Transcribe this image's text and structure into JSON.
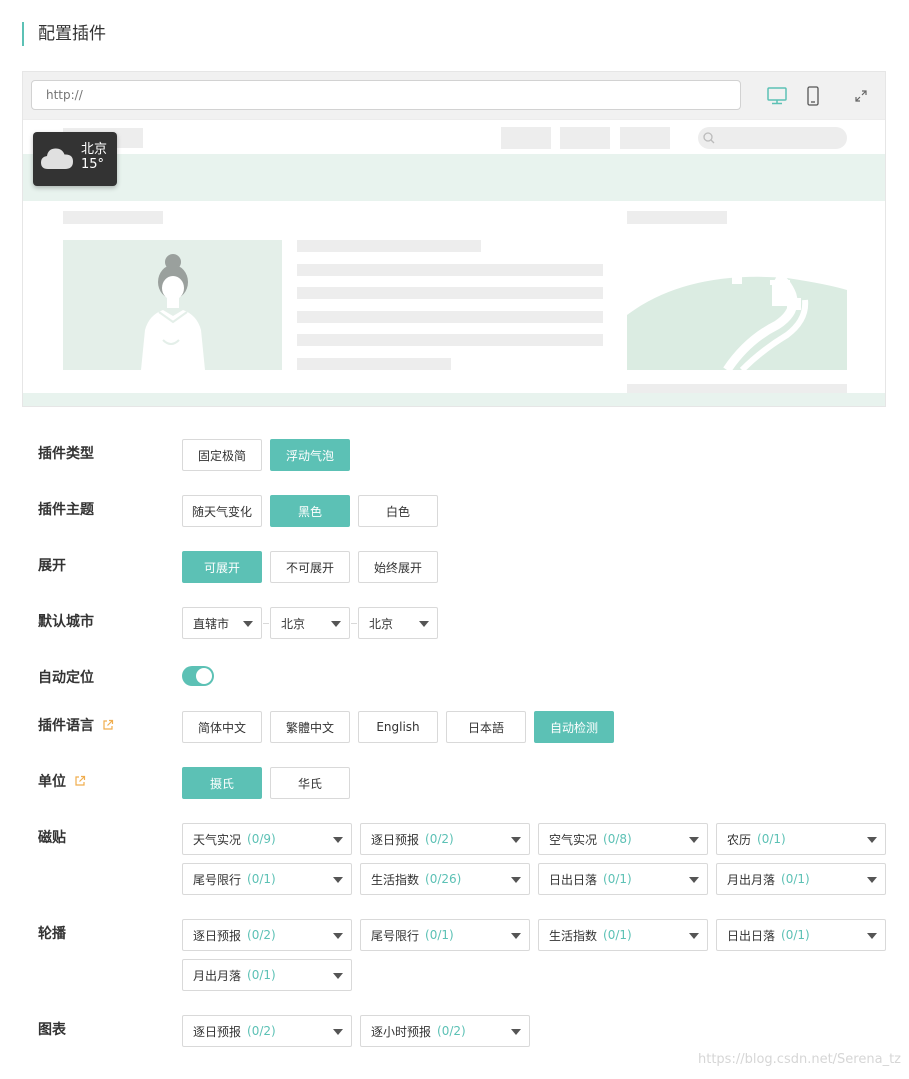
{
  "page_title": "配置插件",
  "preview": {
    "url_placeholder": "http://",
    "device_icons": [
      "desktop-icon",
      "mobile-icon",
      "expand-icon"
    ],
    "widget": {
      "city": "北京",
      "temp": "15°",
      "icon": "cloud-icon"
    }
  },
  "form": {
    "type": {
      "label": "插件类型",
      "options": [
        "固定极简",
        "浮动气泡"
      ],
      "active": 1
    },
    "theme": {
      "label": "插件主题",
      "options": [
        "随天气变化",
        "黑色",
        "白色"
      ],
      "active": 1
    },
    "expand": {
      "label": "展开",
      "options": [
        "可展开",
        "不可展开",
        "始终展开"
      ],
      "active": 0
    },
    "city": {
      "label": "默认城市",
      "selects": [
        "直辖市",
        "北京",
        "北京"
      ]
    },
    "auto_locate": {
      "label": "自动定位",
      "on": true
    },
    "language": {
      "label": "插件语言",
      "options": [
        "简体中文",
        "繁體中文",
        "English",
        "日本語",
        "自动检测"
      ],
      "active": 4
    },
    "unit": {
      "label": "单位",
      "options": [
        "摄氏",
        "华氏"
      ],
      "active": 0
    },
    "tiles": {
      "label": "磁贴",
      "items": [
        {
          "name": "天气实况",
          "count": "(0/9)"
        },
        {
          "name": "逐日预报",
          "count": "(0/2)"
        },
        {
          "name": "空气实况",
          "count": "(0/8)"
        },
        {
          "name": "农历",
          "count": "(0/1)"
        },
        {
          "name": "尾号限行",
          "count": "(0/1)"
        },
        {
          "name": "生活指数",
          "count": "(0/26)"
        },
        {
          "name": "日出日落",
          "count": "(0/1)"
        },
        {
          "name": "月出月落",
          "count": "(0/1)"
        }
      ]
    },
    "carousel": {
      "label": "轮播",
      "items": [
        {
          "name": "逐日预报",
          "count": "(0/2)"
        },
        {
          "name": "尾号限行",
          "count": "(0/1)"
        },
        {
          "name": "生活指数",
          "count": "(0/1)"
        },
        {
          "name": "日出日落",
          "count": "(0/1)"
        },
        {
          "name": "月出月落",
          "count": "(0/1)"
        }
      ]
    },
    "chart": {
      "label": "图表",
      "items": [
        {
          "name": "逐日预报",
          "count": "(0/2)"
        },
        {
          "name": "逐小时预报",
          "count": "(0/2)"
        }
      ]
    }
  },
  "colors": {
    "accent": "#5cc1b5",
    "preview_green": "#e8f3ee",
    "ext_icon": "#f0ad4e"
  },
  "watermark": "https://blog.csdn.net/Serena_tz"
}
